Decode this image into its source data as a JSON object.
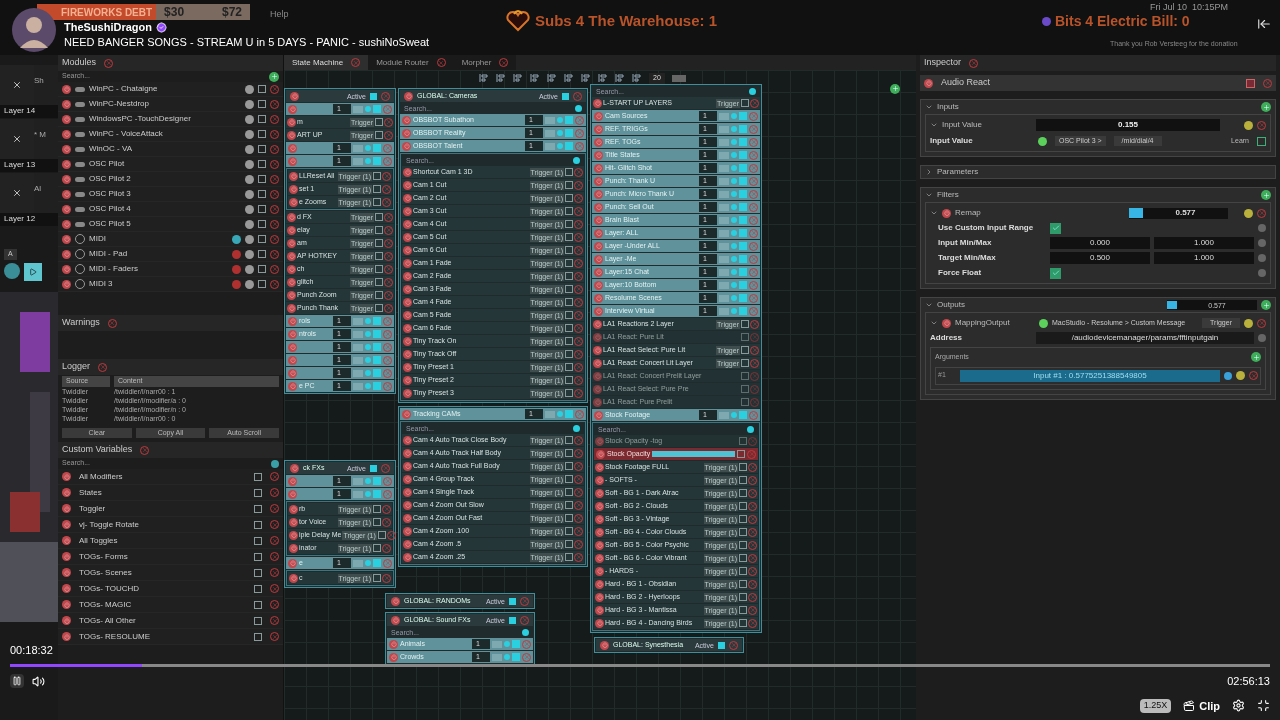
{
  "stream": {
    "channel": "TheSushiDragon",
    "verified": true,
    "title": "NEED BANGER SONGS - STREAM U in 5 DAYS - PANIC - sushiNoSweat"
  },
  "overlays": {
    "debt_label": "FIREWORKS DEBT",
    "debt_paid": "$30",
    "debt_goal": "$72",
    "menu": "Help",
    "subs": "Subs 4 The Warehouse: 1",
    "bits": "Bits 4 Electric Bill: 0",
    "clock": "Fri Jul 10  10:15PM",
    "donation": "Thank you Rob Versteeg for the donation"
  },
  "layers": [
    {
      "label": "Layer 14",
      "peek": "Sh"
    },
    {
      "label": "Layer 13",
      "peek": "* M"
    },
    {
      "label": "Layer 12",
      "peek": "Al"
    }
  ],
  "layer_bar": {
    "letter": "A"
  },
  "modules": {
    "title": "Modules",
    "search": "Search...",
    "items": [
      {
        "name": "WinPC - Chataigne",
        "kind": "osc",
        "checked": false
      },
      {
        "name": "WinPC-Nestdrop",
        "kind": "osc",
        "checked": false
      },
      {
        "name": "WindowsPC -TouchDesigner",
        "kind": "osc",
        "checked": false
      },
      {
        "name": "WinPC - VoiceAttack",
        "kind": "osc",
        "checked": false
      },
      {
        "name": "WinOC - VA",
        "kind": "osc",
        "checked": false
      },
      {
        "name": "OSC Pilot",
        "kind": "osc",
        "checked": false
      },
      {
        "name": "OSC Pilot 2",
        "kind": "osc",
        "checked": false
      },
      {
        "name": "OSC Pilot 3",
        "kind": "osc",
        "checked": false
      },
      {
        "name": "OSC Pilot 4",
        "kind": "osc",
        "checked": false
      },
      {
        "name": "OSC Pilot 5",
        "kind": "osc",
        "checked": false
      },
      {
        "name": "MIDI",
        "kind": "midi",
        "connected": true,
        "checked": false
      },
      {
        "name": "MIDI - Pad",
        "kind": "midi",
        "connected": false,
        "checked": false
      },
      {
        "name": "MIDI - Faders",
        "kind": "midi",
        "connected": false,
        "checked": false
      },
      {
        "name": "MIDI 3",
        "kind": "midi",
        "connected": false,
        "checked": false
      }
    ]
  },
  "warnings": {
    "title": "Warnings"
  },
  "logger": {
    "title": "Logger",
    "columns": [
      "Source",
      "Content"
    ],
    "rows": [
      [
        "Twiddler",
        "/twiddler/l/narr00 : 1"
      ],
      [
        "Twiddler",
        "/twiddler/l/modifier/a : 0"
      ],
      [
        "Twiddler",
        "/twiddler/l/modifier/n : 0"
      ],
      [
        "Twiddler",
        "/twiddler/l/narr00 : 0"
      ]
    ],
    "buttons": [
      "Clear",
      "Copy All",
      "Auto Scroll"
    ]
  },
  "custom_variables": {
    "title": "Custom Variables",
    "search": "Search...",
    "items": [
      {
        "name": "All Modifiers",
        "checked": false
      },
      {
        "name": "States",
        "checked": false
      },
      {
        "name": "Toggler",
        "checked": false
      },
      {
        "name": "vj- Toggle Rotate",
        "checked": false
      },
      {
        "name": "All Toggles",
        "checked": false
      },
      {
        "name": "TOGs- Forms",
        "checked": false
      },
      {
        "name": "TOGs- Scenes",
        "checked": false
      },
      {
        "name": "TOGs- TOUCHD",
        "checked": false
      },
      {
        "name": "TOGs- MAGIC",
        "checked": false
      },
      {
        "name": "TOGs- All Other",
        "checked": false
      },
      {
        "name": "TOGs- RESOLUME",
        "checked": false
      }
    ]
  },
  "tabs": [
    {
      "label": "State Machine",
      "selected": true
    },
    {
      "label": "Module Router",
      "selected": false
    },
    {
      "label": "Morpher",
      "selected": false
    }
  ],
  "canvas": {
    "zoom": "20",
    "nodes": [
      {
        "status": "Active",
        "active": true,
        "items": [
          {
            "kind": "group",
            "count": "1",
            "enabled": true
          },
          {
            "kind": "trigger",
            "label": "m",
            "button": "Trigger",
            "enabled": true
          },
          {
            "kind": "trigger",
            "label": "ART UP",
            "button": "Trigger",
            "enabled": true
          },
          {
            "kind": "group",
            "count": "1",
            "enabled": true
          },
          {
            "kind": "group",
            "count": "1",
            "enabled": true,
            "children": [
              {
                "kind": "trigger",
                "label": "LLReset All",
                "button": "Trigger (1)",
                "enabled": true
              },
              {
                "kind": "trigger",
                "label": "set 1",
                "button": "Trigger (1)",
                "enabled": true
              },
              {
                "kind": "trigger",
                "label": "e Zooms",
                "button": "Trigger (1)",
                "enabled": true
              }
            ]
          },
          {
            "kind": "trigger",
            "label": "d FX",
            "button": "Trigger",
            "enabled": true
          },
          {
            "kind": "trigger",
            "label": "elay",
            "button": "Trigger",
            "enabled": true
          },
          {
            "kind": "trigger",
            "label": "am",
            "button": "Trigger",
            "enabled": true
          },
          {
            "kind": "trigger",
            "label": "AP HOTKEY",
            "button": "Trigger",
            "enabled": true
          },
          {
            "kind": "trigger",
            "label": "ch",
            "button": "Trigger",
            "enabled": true
          },
          {
            "kind": "trigger",
            "label": "glitch",
            "button": "Trigger",
            "enabled": true
          },
          {
            "kind": "trigger",
            "label": "Punch Zoom",
            "button": "Trigger",
            "enabled": true
          },
          {
            "kind": "trigger",
            "label": "Punch Thank",
            "button": "Trigger",
            "enabled": true
          },
          {
            "kind": "group",
            "label": "rols",
            "count": "1",
            "enabled": true
          },
          {
            "kind": "group",
            "label": "ntrols",
            "count": "1",
            "enabled": true
          },
          {
            "kind": "group",
            "count": "1",
            "enabled": true
          },
          {
            "kind": "group",
            "count": "1",
            "enabled": true
          },
          {
            "kind": "group",
            "count": "1",
            "enabled": true
          },
          {
            "kind": "group",
            "label": "e PC",
            "count": "1",
            "enabled": true
          }
        ]
      },
      {
        "title": "ck FXs",
        "status": "Active",
        "active": true,
        "items": [
          {
            "kind": "group",
            "count": "1",
            "enabled": true
          },
          {
            "kind": "group",
            "count": "1",
            "enabled": true,
            "children": [
              {
                "kind": "trigger",
                "label": "rb",
                "button": "Trigger (1)",
                "enabled": true
              },
              {
                "kind": "trigger",
                "label": "tor Voice",
                "button": "Trigger (1)",
                "enabled": true
              },
              {
                "kind": "trigger",
                "label": "iple Delay Me",
                "button": "Trigger (1)",
                "enabled": true
              },
              {
                "kind": "trigger",
                "label": "inator",
                "button": "Trigger (1)",
                "enabled": true
              }
            ]
          },
          {
            "kind": "group",
            "label": "e",
            "count": "1",
            "enabled": true,
            "children": [
              {
                "kind": "trigger",
                "label": "c",
                "button": "Trigger (1)",
                "enabled": true
              }
            ]
          }
        ]
      },
      {
        "title": "GLOBAL: Cameras",
        "status": "Active",
        "active": true,
        "search": "Search...",
        "items": [
          {
            "kind": "group",
            "label": "OBSBOT Subathon",
            "count": "1",
            "enabled": true
          },
          {
            "kind": "group",
            "label": "OBSBOT Reality",
            "count": "1",
            "enabled": true
          },
          {
            "kind": "group",
            "label": "OBSBOT Talent",
            "count": "1",
            "enabled": true,
            "search": "Search...",
            "children": [
              {
                "kind": "trigger",
                "label": "Shortcut Cam 1 3D",
                "button": "Trigger (1)",
                "enabled": true
              },
              {
                "kind": "trigger",
                "label": "Cam 1 Cut",
                "button": "Trigger (1)",
                "enabled": true
              },
              {
                "kind": "trigger",
                "label": "Cam 2 Cut",
                "button": "Trigger (1)",
                "enabled": true
              },
              {
                "kind": "trigger",
                "label": "Cam 3 Cut",
                "button": "Trigger (1)",
                "enabled": true
              },
              {
                "kind": "trigger",
                "label": "Cam 4 Cut",
                "button": "Trigger (1)",
                "enabled": true
              },
              {
                "kind": "trigger",
                "label": "Cam 5 Cut",
                "button": "Trigger (1)",
                "enabled": true
              },
              {
                "kind": "trigger",
                "label": "Cam 6 Cut",
                "button": "Trigger (1)",
                "enabled": true
              },
              {
                "kind": "trigger",
                "label": "Cam 1 Fade",
                "button": "Trigger (1)",
                "enabled": true
              },
              {
                "kind": "trigger",
                "label": "Cam 2 Fade",
                "button": "Trigger (1)",
                "enabled": true
              },
              {
                "kind": "trigger",
                "label": "Cam 3 Fade",
                "button": "Trigger (1)",
                "enabled": true
              },
              {
                "kind": "trigger",
                "label": "Cam 4 Fade",
                "button": "Trigger (1)",
                "enabled": true
              },
              {
                "kind": "trigger",
                "label": "Cam 5 Fade",
                "button": "Trigger (1)",
                "enabled": true
              },
              {
                "kind": "trigger",
                "label": "Cam 6 Fade",
                "button": "Trigger (1)",
                "enabled": true
              },
              {
                "kind": "trigger",
                "label": "Tiny Track On",
                "button": "Trigger (1)",
                "enabled": true
              },
              {
                "kind": "trigger",
                "label": "Tiny Track Off",
                "button": "Trigger (1)",
                "enabled": true
              },
              {
                "kind": "trigger",
                "label": "Tiny Preset 1",
                "button": "Trigger (1)",
                "enabled": true
              },
              {
                "kind": "trigger",
                "label": "Tiny Preset 2",
                "button": "Trigger (1)",
                "enabled": true
              },
              {
                "kind": "trigger",
                "label": "Tiny Preset 3",
                "button": "Trigger (1)",
                "enabled": true
              }
            ]
          }
        ]
      },
      {
        "items": [
          {
            "kind": "group",
            "label": "Tracking CAMs",
            "count": "1",
            "enabled": true,
            "search": "Search...",
            "children": [
              {
                "kind": "trigger",
                "label": "Cam 4 Auto Track Close Body",
                "button": "Trigger (1)",
                "enabled": true
              },
              {
                "kind": "trigger",
                "label": "Cam 4 Auto Track Half Body",
                "button": "Trigger (1)",
                "enabled": true
              },
              {
                "kind": "trigger",
                "label": "Cam 4 Auto Track Full Body",
                "button": "Trigger (1)",
                "enabled": true
              },
              {
                "kind": "trigger",
                "label": "Cam 4 Group Track",
                "button": "Trigger (1)",
                "enabled": true
              },
              {
                "kind": "trigger",
                "label": "Cam 4 Single Track",
                "button": "Trigger (1)",
                "enabled": true
              },
              {
                "kind": "trigger",
                "label": "Cam 4 Zoom Out Slow",
                "button": "Trigger (1)",
                "enabled": true
              },
              {
                "kind": "trigger",
                "label": "Cam 4 Zoom Out Fast",
                "button": "Trigger (1)",
                "enabled": true
              },
              {
                "kind": "trigger",
                "label": "Cam 4 Zoom .100",
                "button": "Trigger (1)",
                "enabled": true
              },
              {
                "kind": "trigger",
                "label": "Cam 4 Zoom .5",
                "button": "Trigger (1)",
                "enabled": true
              },
              {
                "kind": "trigger",
                "label": "Cam 4 Zoom .25",
                "button": "Trigger (1)",
                "enabled": true
              }
            ]
          }
        ]
      },
      {
        "title": "GLOBAL: RANDOMs",
        "status": "Active",
        "active": true
      },
      {
        "title": "GLOBAL: Sound FXs",
        "status": "Active",
        "active": true,
        "search": "Search...",
        "items": [
          {
            "kind": "group",
            "label": "Animals",
            "count": "1",
            "enabled": true
          },
          {
            "kind": "group",
            "label": "Crowds",
            "count": "1",
            "enabled": true
          }
        ]
      },
      {
        "search": "Search...",
        "items": [
          {
            "kind": "trigger",
            "label": "L-START UP LAYERS",
            "button": "Trigger",
            "enabled": true
          },
          {
            "kind": "group",
            "label": "Cam Sources",
            "count": "1",
            "enabled": true
          },
          {
            "kind": "group",
            "label": "REF. TRIGGs",
            "count": "1",
            "enabled": true
          },
          {
            "kind": "group",
            "label": "REF. TOGs",
            "count": "1",
            "enabled": true
          },
          {
            "kind": "group",
            "label": "Title States",
            "count": "1",
            "enabled": true
          },
          {
            "kind": "group",
            "label": "Hit- Glitch Shot",
            "count": "1",
            "enabled": true
          },
          {
            "kind": "group",
            "label": "Punch: Thank U",
            "count": "1",
            "enabled": true
          },
          {
            "kind": "group",
            "label": "Punch: Micro Thank U",
            "count": "1",
            "enabled": true
          },
          {
            "kind": "group",
            "label": "Punch: Sell Out",
            "count": "1",
            "enabled": true
          },
          {
            "kind": "group",
            "label": "Brain Blast",
            "count": "1",
            "enabled": true
          },
          {
            "kind": "group",
            "label": "Layer: ALL",
            "count": "1",
            "enabled": true
          },
          {
            "kind": "group",
            "label": "Layer -Under ALL",
            "count": "1",
            "enabled": true
          },
          {
            "kind": "group",
            "label": "Layer -Me",
            "count": "1",
            "enabled": true
          },
          {
            "kind": "group",
            "label": "Layer:15 Chat",
            "count": "1",
            "enabled": true
          },
          {
            "kind": "group",
            "label": "Layer:10 Bottom",
            "count": "1",
            "enabled": true
          },
          {
            "kind": "group",
            "label": "Resolume Scenes",
            "count": "1",
            "enabled": true
          },
          {
            "kind": "group",
            "label": "Interview Virtual",
            "count": "1",
            "enabled": true
          },
          {
            "kind": "trigger",
            "label": "LA1 Reactions 2 Layer",
            "button": "Trigger",
            "enabled": true
          },
          {
            "kind": "trigger",
            "label": "LA1 React: Pure Lit",
            "enabled": false
          },
          {
            "kind": "trigger",
            "label": "LA1 React Select: Pure Lit",
            "button": "Trigger",
            "enabled": true
          },
          {
            "kind": "trigger",
            "label": "LA1 React: Concert Lit Layer",
            "button": "Trigger",
            "enabled": true
          },
          {
            "kind": "trigger",
            "label": "LA1 React: Concert Prelit Layer",
            "enabled": false
          },
          {
            "kind": "trigger",
            "label": "LA1 React Select: Pure Pre",
            "enabled": false
          },
          {
            "kind": "trigger",
            "label": "LA1 React: Pure Prelit",
            "enabled": false
          },
          {
            "kind": "group",
            "label": "Stock Footage",
            "count": "1",
            "enabled": true,
            "search": "Search...",
            "children": [
              {
                "kind": "trigger",
                "label": "Stock Opacity -tog",
                "enabled": false
              },
              {
                "kind": "slider",
                "label": "Stock Opacity",
                "enabled": true
              },
              {
                "kind": "trigger",
                "label": "Stock Footage FULL",
                "button": "Trigger (1)",
                "enabled": true
              },
              {
                "kind": "trigger",
                "label": "- SOFTS -",
                "button": "Trigger (1)",
                "enabled": true
              },
              {
                "kind": "trigger",
                "label": "Soft - BG 1 - Dark Atrac",
                "button": "Trigger (1)",
                "enabled": true
              },
              {
                "kind": "trigger",
                "label": "Soft - BG 2 - Clouds",
                "button": "Trigger (1)",
                "enabled": true
              },
              {
                "kind": "trigger",
                "label": "Soft - BG 3 - Vintage",
                "button": "Trigger (1)",
                "enabled": true
              },
              {
                "kind": "trigger",
                "label": "Soft - BG 4 - Color Clouds",
                "button": "Trigger (1)",
                "enabled": true
              },
              {
                "kind": "trigger",
                "label": "Soft - BG 5 - Color Psychic",
                "button": "Trigger (1)",
                "enabled": true
              },
              {
                "kind": "trigger",
                "label": "Soft - BG 6 - Color Vibrant",
                "button": "Trigger (1)",
                "enabled": true
              },
              {
                "kind": "trigger",
                "label": "- HARDS -",
                "button": "Trigger (1)",
                "enabled": true
              },
              {
                "kind": "trigger",
                "label": "Hard - BG 1 - Obsidian",
                "button": "Trigger (1)",
                "enabled": true
              },
              {
                "kind": "trigger",
                "label": "Hard - BG 2 - Hyerloops",
                "button": "Trigger (1)",
                "enabled": true
              },
              {
                "kind": "trigger",
                "label": "Hard - BG 3 - Mantissa",
                "button": "Trigger (1)",
                "enabled": true
              },
              {
                "kind": "trigger",
                "label": "Hard - BG 4 - Dancing Birds",
                "button": "Trigger (1)",
                "enabled": true
              }
            ]
          }
        ]
      },
      {
        "title": "GLOBAL: Synesthesia",
        "status": "Active",
        "active": true
      }
    ]
  },
  "inspector": {
    "title": "Inspector",
    "item": "Audio React",
    "inputs": {
      "title": "Inputs",
      "param": "Input Value",
      "value": "0.155",
      "label": "Input Value",
      "source": "OSC Pilot 3 >",
      "address": "/mid/dial/4",
      "learn": "Learn",
      "learn_checked": false
    },
    "parameters": {
      "title": "Parameters",
      "expanded": false
    },
    "filters": {
      "title": "Filters",
      "filter": "Remap",
      "value": "0.577",
      "rows": [
        {
          "kind": "check",
          "label": "Use Custom Input Range",
          "checked": true
        },
        {
          "kind": "pair",
          "label": "Input Min/Max",
          "values": [
            "0.000",
            "1.000"
          ]
        },
        {
          "kind": "pair",
          "label": "Target Min/Max",
          "values": [
            "0.500",
            "1.000"
          ]
        },
        {
          "kind": "check",
          "label": "Force Float",
          "checked": true
        }
      ]
    },
    "outputs": {
      "title": "Outputs",
      "value": "0.577",
      "output": "MappingOutput",
      "target": "MacStudio - Resolume > Custom Message",
      "button": "Trigger",
      "address_label": "Address",
      "address": "/audiodevicemanager/params/fftinputgain",
      "arguments": "Arguments",
      "arg_index": "#1",
      "arg_value": "Input #1 : 0.5775251388549805"
    }
  },
  "player": {
    "elapsed": "00:18:32",
    "duration": "02:56:13",
    "level": 0.105,
    "speed": "1.25X",
    "clip": "Clip",
    "playing": true
  }
}
